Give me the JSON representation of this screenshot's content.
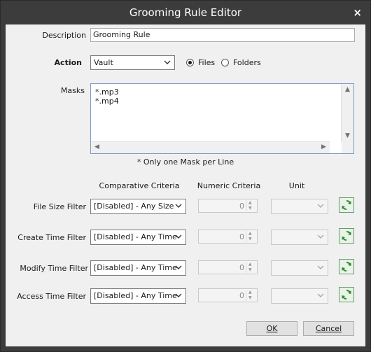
{
  "window": {
    "title": "Grooming Rule Editor",
    "close_glyph": "×"
  },
  "description": {
    "label": "Description",
    "value": "Grooming Rule"
  },
  "action": {
    "label": "Action",
    "value": "Vault",
    "files_label": "Files",
    "folders_label": "Folders",
    "selected": "Files"
  },
  "masks": {
    "label": "Masks",
    "lines": "*.mp3\n*.mp4",
    "hint": "* Only one Mask per Line"
  },
  "columns": {
    "comparative": "Comparative Criteria",
    "numeric": "Numeric Criteria",
    "unit": "Unit"
  },
  "filters": [
    {
      "label": "File Size Filter",
      "criteria": "[Disabled] - Any Size",
      "value": "0",
      "unit": ""
    },
    {
      "label": "Create Time Filter",
      "criteria": "[Disabled] - Any Time",
      "value": "0",
      "unit": ""
    },
    {
      "label": "Modify Time Filter",
      "criteria": "[Disabled] - Any Time",
      "value": "0",
      "unit": ""
    },
    {
      "label": "Access Time Filter",
      "criteria": "[Disabled] - Any Time",
      "value": "0",
      "unit": ""
    }
  ],
  "buttons": {
    "ok": "OK",
    "cancel": "Cancel"
  },
  "colors": {
    "titlebar": "#3c3c3c",
    "client": "#f0f0f0",
    "refresh_green": "#2e8b2e"
  }
}
